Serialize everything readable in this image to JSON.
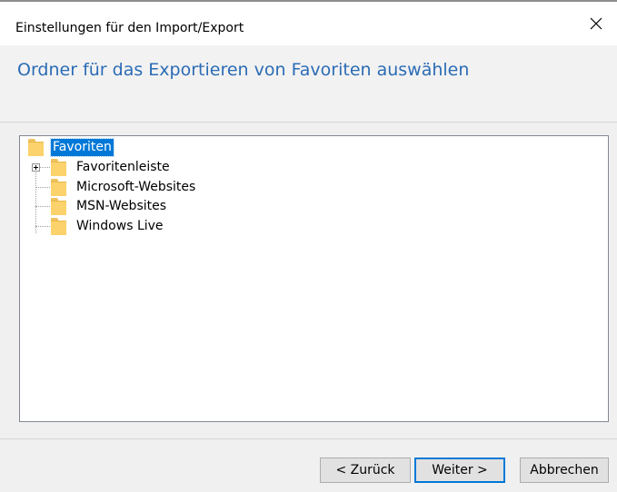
{
  "window": {
    "title": "Einstellungen für den Import/Export"
  },
  "header": {
    "heading": "Ordner für das Exportieren von Favoriten auswählen"
  },
  "tree": {
    "root": {
      "label": "Favoriten",
      "selected": true
    },
    "children": [
      {
        "label": "Favoritenleiste",
        "expandable": true
      },
      {
        "label": "Microsoft-Websites",
        "expandable": false
      },
      {
        "label": "MSN-Websites",
        "expandable": false
      },
      {
        "label": "Windows Live",
        "expandable": false
      }
    ]
  },
  "buttons": {
    "back": "< Zurück",
    "next": "Weiter >",
    "cancel": "Abbrechen"
  },
  "colors": {
    "heading": "#2b6cb5",
    "selection": "#0078d7",
    "folder": "#fbd26b",
    "default_button_border": "#0078d7"
  },
  "icons": {
    "close": "close-icon",
    "folder": "folder-icon",
    "expander": "plus-expander-icon"
  }
}
